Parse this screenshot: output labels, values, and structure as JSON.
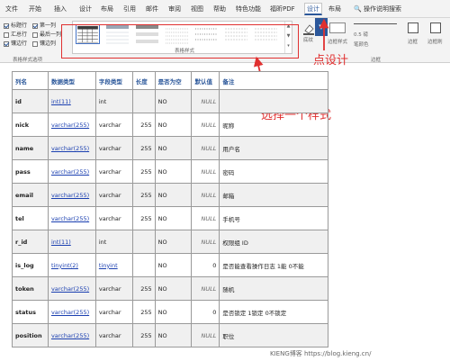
{
  "menu": {
    "tabs": [
      "文件",
      "开始",
      "插入",
      "设计",
      "布局",
      "引用",
      "邮件",
      "审阅",
      "视图",
      "帮助",
      "特色功能",
      "福昕PDF",
      "设计",
      "布局"
    ],
    "search": "操作说明搜索"
  },
  "ribbon": {
    "options": [
      {
        "label": "标题行",
        "checked": true
      },
      {
        "label": "第一列",
        "checked": true
      },
      {
        "label": "汇总行",
        "checked": false
      },
      {
        "label": "最后一列",
        "checked": false
      },
      {
        "label": "镶边行",
        "checked": true
      },
      {
        "label": "镶边列",
        "checked": false
      }
    ],
    "options_group": "表格样式选项",
    "styles_group": "表格样式",
    "shading": "底纹",
    "border_styles": "边框样式",
    "pen_weight": "0.5 磅",
    "pen_color": "笔颜色",
    "borders": "边框",
    "border_painter": "边框刷",
    "borders_group": "边框"
  },
  "annotations": {
    "click_design": "点设计",
    "choose_style": "选择一个样式"
  },
  "table": {
    "headers": [
      "列名",
      "数据类型",
      "字段类型",
      "长度",
      "是否为空",
      "默认值",
      "备注"
    ],
    "rows": [
      [
        "id",
        "int(11)",
        "int",
        "",
        "NO",
        "NULL",
        ""
      ],
      [
        "nick",
        "varchar(255)",
        "varchar",
        "255",
        "NO",
        "NULL",
        "昵称"
      ],
      [
        "name",
        "varchar(255)",
        "varchar",
        "255",
        "NO",
        "NULL",
        "用户名"
      ],
      [
        "pass",
        "varchar(255)",
        "varchar",
        "255",
        "NO",
        "NULL",
        "密码"
      ],
      [
        "email",
        "varchar(255)",
        "varchar",
        "255",
        "NO",
        "NULL",
        "邮箱"
      ],
      [
        "tel",
        "varchar(255)",
        "varchar",
        "255",
        "NO",
        "NULL",
        "手机号"
      ],
      [
        "r_id",
        "int(11)",
        "int",
        "",
        "NO",
        "NULL",
        "权限组 ID"
      ],
      [
        "is_log",
        "tinyint(2)",
        "tinyint",
        "",
        "NO",
        "0",
        "是否能查看操作日志 1能 0不能"
      ],
      [
        "token",
        "varchar(255)",
        "varchar",
        "255",
        "NO",
        "NULL",
        "随机"
      ],
      [
        "status",
        "varchar(255)",
        "varchar",
        "255",
        "NO",
        "0",
        "是否锁定 1锁定 0不锁定"
      ],
      [
        "position",
        "varchar(255)",
        "varchar",
        "255",
        "NO",
        "NULL",
        "职位"
      ]
    ]
  },
  "footer": "KIENG博客 https://blog.kieng.cn/",
  "colors": {
    "accent": "#2b579a",
    "annotation": "#e03030"
  }
}
